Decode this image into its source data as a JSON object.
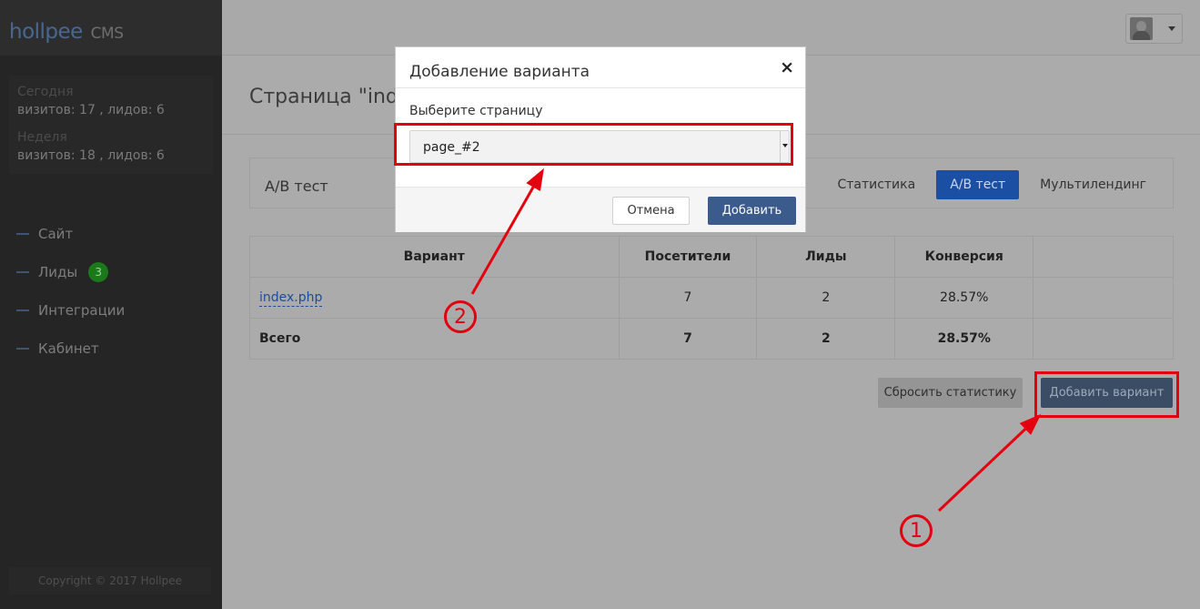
{
  "sidebar": {
    "logo": "hollpee",
    "logo_suffix": "CMS",
    "stats": {
      "today_label": "Сегодня",
      "today_value": "визитов: 17 , лидов: 6",
      "week_label": "Неделя",
      "week_value": "визитов: 18 , лидов: 6"
    },
    "nav": [
      {
        "label": "Сайт"
      },
      {
        "label": "Лиды",
        "badge": "3"
      },
      {
        "label": "Интеграции"
      },
      {
        "label": "Кабинет"
      }
    ],
    "copyright": "Copyright © 2017 Hollpee"
  },
  "page": {
    "title": "Страница \"index"
  },
  "ab_panel": {
    "title": "A/B тест",
    "tabs": [
      "Статистика",
      "A/B тест",
      "Мультилендинг"
    ],
    "active_tab": "A/B тест"
  },
  "table": {
    "headers": [
      "Вариант",
      "Посетители",
      "Лиды",
      "Конверсия",
      ""
    ],
    "rows": [
      {
        "variant": "index.php",
        "visitors": "7",
        "leads": "2",
        "conversion": "28.57%"
      }
    ],
    "total": {
      "label": "Всего",
      "visitors": "7",
      "leads": "2",
      "conversion": "28.57%"
    }
  },
  "actions": {
    "reset_label": "Сбросить статистику",
    "add_variant_label": "Добавить вариант"
  },
  "modal": {
    "title": "Добавление варианта",
    "close": "×",
    "field_label": "Выберите страницу",
    "select_value": "page_#2",
    "cancel_label": "Отмена",
    "add_label": "Добавить"
  },
  "annotations": {
    "marker_1": "1",
    "marker_2": "2",
    "color": "#e3000f"
  }
}
